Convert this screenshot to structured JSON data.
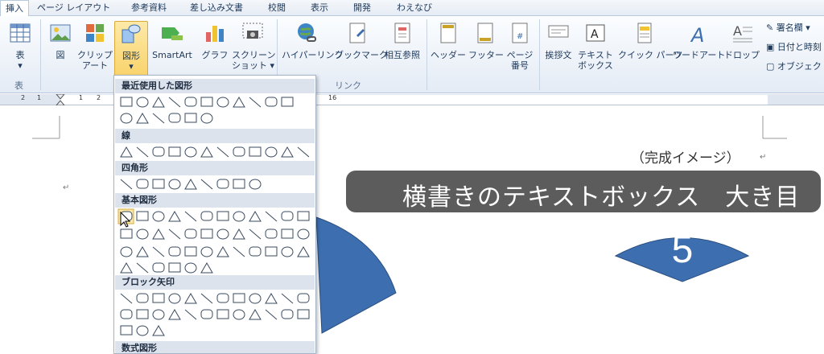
{
  "tabs": [
    {
      "label": "挿入",
      "active": true
    },
    {
      "label": "ページ レイアウト"
    },
    {
      "label": "参考資料"
    },
    {
      "label": "差し込み文書"
    },
    {
      "label": "校閲"
    },
    {
      "label": "表示"
    },
    {
      "label": "開発"
    },
    {
      "label": "わえなび"
    }
  ],
  "ribbon": {
    "table": {
      "label": "表",
      "arrow": "▾",
      "group": "表"
    },
    "picture": {
      "label": "図"
    },
    "clipart": {
      "label1": "クリップ",
      "label2": "アート"
    },
    "shapes": {
      "label": "図形",
      "arrow": "▾"
    },
    "smartart": {
      "label": "SmartArt"
    },
    "chart": {
      "label": "グラフ"
    },
    "screenshot": {
      "label1": "スクリーン",
      "label2": "ショット ▾"
    },
    "hyperlink": {
      "label": "ハイパーリンク"
    },
    "bookmark": {
      "label": "ブックマーク"
    },
    "crossref": {
      "label": "相互参照"
    },
    "header": {
      "label": "ヘッダー"
    },
    "footer": {
      "label": "フッター"
    },
    "pagenum": {
      "label1": "ページ",
      "label2": "番号"
    },
    "greeting": {
      "label": "挨拶文"
    },
    "textbox": {
      "label": "テキスト",
      "label2": "ボックス"
    },
    "quickparts": {
      "label": "クイック パーツ"
    },
    "wordart": {
      "label": "ワードアート"
    },
    "dropcap": {
      "label": "ドロップ"
    },
    "link_group": "リンク",
    "signature": "署名欄 ▾",
    "datetime": "日付と時刻",
    "object": "オブジェクト"
  },
  "ruler": {
    "left_marks": [
      "2",
      "1",
      "1",
      "2"
    ],
    "mid_mark": "16"
  },
  "document": {
    "caption": "（完成イメージ）",
    "fan_number": "5",
    "banner": "横書きのテキストボックス　大き目",
    "fan_color": "#3d6fb0"
  },
  "shapes_menu": {
    "sections": [
      "最近使用した図形",
      "線",
      "四角形",
      "基本図形",
      "ブロック矢印",
      "数式図形"
    ]
  }
}
